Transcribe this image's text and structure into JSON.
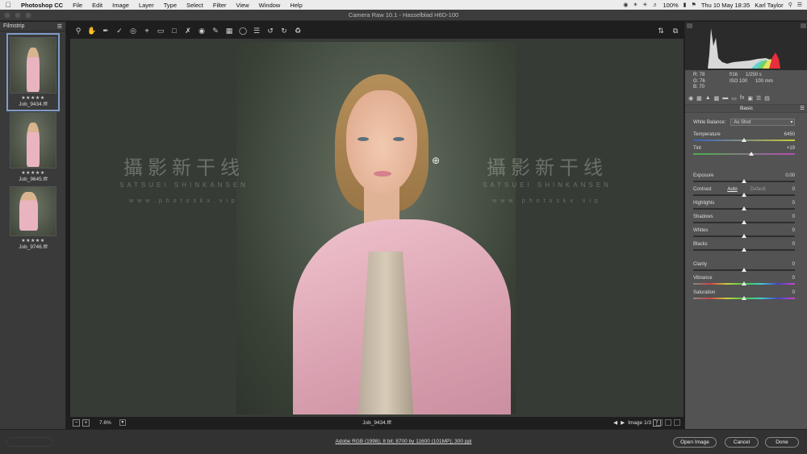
{
  "menubar": {
    "app": "Photoshop CC",
    "items": [
      "File",
      "Edit",
      "Image",
      "Layer",
      "Type",
      "Select",
      "Filter",
      "View",
      "Window",
      "Help"
    ],
    "battery": "100%",
    "datetime": "Thu 10 May  18:35",
    "user": "Karl Taylor"
  },
  "window": {
    "title": "Camera Raw 10.1  -  Hasselblad H6D-100"
  },
  "filmstrip": {
    "title": "Filmstrip",
    "items": [
      {
        "name": "Job_9434.fff",
        "stars": "★★★★★",
        "selected": true
      },
      {
        "name": "Job_9645.fff",
        "stars": "★★★★★",
        "selected": false
      },
      {
        "name": "Job_9746.fff",
        "stars": "★★★★★",
        "selected": false
      }
    ]
  },
  "watermark": {
    "cn": "攝影新干线",
    "en": "SATSUEI SHINKANSEN",
    "url": "www.photoskx.vip"
  },
  "status": {
    "zoom": "7.6%",
    "filename": "Job_9434.fff",
    "image_count": "Image 1/3",
    "y_label": "Y"
  },
  "readout": {
    "r": "R:    78",
    "g": "G:    76",
    "b": "B:    70",
    "aperture": "f/16",
    "shutter": "1/250 s",
    "iso": "ISO 100",
    "focal": "100 mm"
  },
  "panel": {
    "title": "Basic",
    "white_balance_label": "White Balance:",
    "white_balance_value": "As Shot",
    "auto": "Auto",
    "default": "Default",
    "sliders": [
      {
        "label": "Temperature",
        "value": "6450",
        "pos": 0.5
      },
      {
        "label": "Tint",
        "value": "+19",
        "pos": 0.57
      },
      {
        "label": "Exposure",
        "value": "0.00",
        "pos": 0.5
      },
      {
        "label": "Contrast",
        "value": "0",
        "pos": 0.5
      },
      {
        "label": "Highlights",
        "value": "0",
        "pos": 0.5
      },
      {
        "label": "Shadows",
        "value": "0",
        "pos": 0.5
      },
      {
        "label": "Whites",
        "value": "0",
        "pos": 0.5
      },
      {
        "label": "Blacks",
        "value": "0",
        "pos": 0.5
      },
      {
        "label": "Clarity",
        "value": "0",
        "pos": 0.5
      },
      {
        "label": "Vibrance",
        "value": "0",
        "pos": 0.5
      },
      {
        "label": "Saturation",
        "value": "0",
        "pos": 0.5
      }
    ]
  },
  "bottom": {
    "info": "Adobe RGB (1998); 8 bit; 8700 by 11600 (101MP); 300 ppi",
    "open_image": "Open Image",
    "cancel": "Cancel",
    "done": "Done"
  },
  "colors": {
    "accent": "#7f9cc7",
    "panel": "#535353",
    "preview_bg": "#363b35"
  }
}
